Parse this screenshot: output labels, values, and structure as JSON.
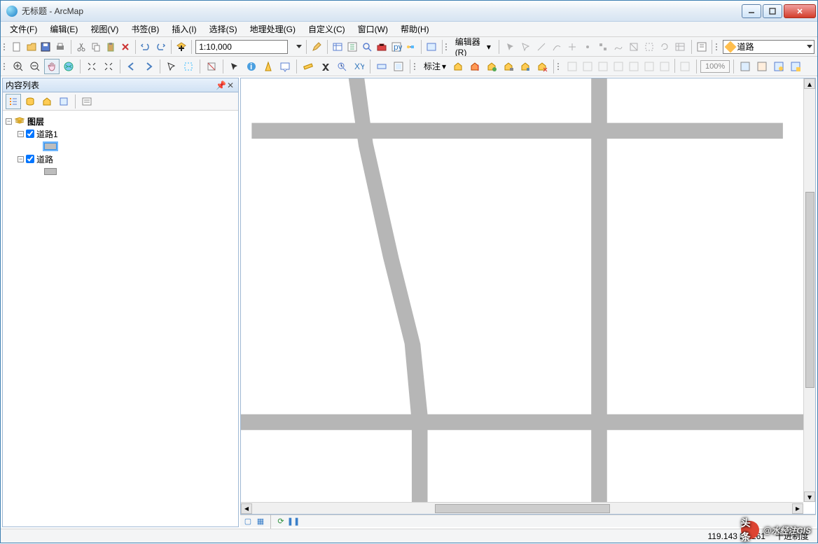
{
  "window": {
    "title": "无标题 - ArcMap"
  },
  "menu": [
    "文件(F)",
    "编辑(E)",
    "视图(V)",
    "书签(B)",
    "插入(I)",
    "选择(S)",
    "地理处理(G)",
    "自定义(C)",
    "窗口(W)",
    "帮助(H)"
  ],
  "scale": "1:10,000",
  "editor_label": "编辑器(R)",
  "label_tool": "标注",
  "layer_selector": "道路",
  "percent": "100%",
  "toc": {
    "title": "内容列表",
    "root": "图层",
    "layers": [
      {
        "name": "道路1",
        "checked": true,
        "selected": true
      },
      {
        "name": "道路",
        "checked": true,
        "selected": false
      }
    ]
  },
  "status": {
    "coords": "119.143 25.261",
    "units": "十进制度"
  },
  "watermark": {
    "prefix": "头条",
    "text": "@水经注GIS"
  }
}
